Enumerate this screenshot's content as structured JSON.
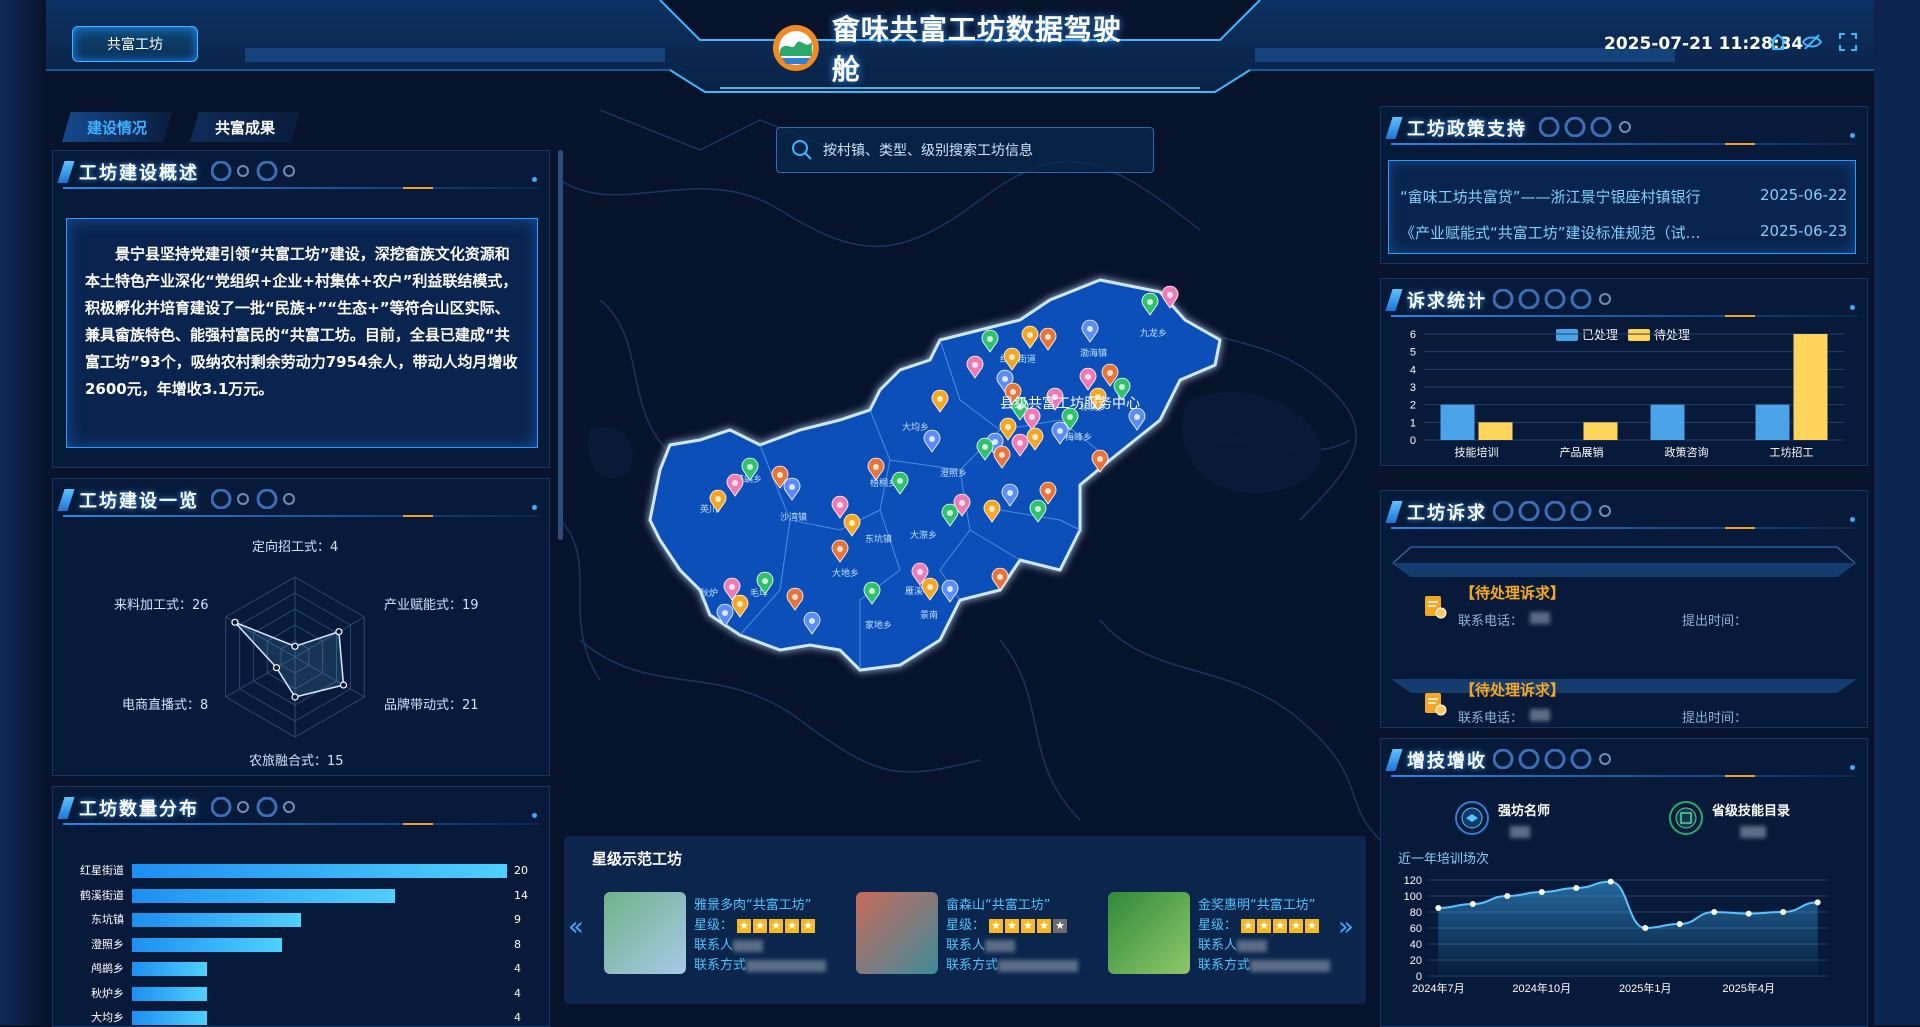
{
  "header": {
    "title": "畲味共富工坊数据驾驶舱",
    "tag_button": "共富工坊",
    "datetime": "2025-07-21 11:28:34",
    "icons": [
      "home-icon",
      "hide-icon",
      "fullscreen-icon"
    ]
  },
  "tabs": [
    {
      "label": "建设情况",
      "active": true
    },
    {
      "label": "共富成果",
      "active": false
    }
  ],
  "overview": {
    "title": "工坊建设概述",
    "text": "景宁县坚持党建引领“共富工坊”建设，深挖畲族文化资源和本土特色产业深化“党组织+企业+村集体+农户”利益联结模式，积极孵化并培育建设了一批“民族+”“生态+”等符合山区实际、兼具畲族特色、能强村富民的“共富工坊。目前，全县已建成“共富工坊”93个，吸纳农村剩余劳动力7954余人，带动人均月增收2600元，年增收3.1万元。"
  },
  "construction": {
    "title": "工坊建设一览",
    "labels": {
      "top": "定向招工式：4",
      "upper_right": "产业赋能式：19",
      "lower_right": "品牌带动式：21",
      "bottom": "农旅融合式：15",
      "lower_left": "电商直播式：8",
      "upper_left": "来料加工式：26"
    },
    "values": [
      4,
      19,
      21,
      15,
      8,
      26
    ],
    "max": 30
  },
  "distribution": {
    "title": "工坊数量分布",
    "items": [
      {
        "name": "红星街道",
        "value": 20
      },
      {
        "name": "鹤溪街道",
        "value": 14
      },
      {
        "name": "东坑镇",
        "value": 9
      },
      {
        "name": "澄照乡",
        "value": 8
      },
      {
        "name": "鸬鹚乡",
        "value": 4
      },
      {
        "name": "秋炉乡",
        "value": 4
      },
      {
        "name": "大均乡",
        "value": 4
      }
    ],
    "max": 20
  },
  "search": {
    "placeholder": "按村镇、类型、级别搜索工坊信息"
  },
  "map": {
    "center_label": "县级共富工坊服务中心",
    "towns": [
      "九龙乡",
      "渤海镇",
      "红星街道",
      "大均乡",
      "梅峰乡",
      "澄照乡",
      "鸬鹚乡",
      "梧桐乡",
      "沙湾镇",
      "英川",
      "东坑镇",
      "大漈乡",
      "标溪乡",
      "大地乡",
      "雁溪",
      "秋炉",
      "毛垟",
      "家地乡",
      "景南"
    ]
  },
  "star_workshops": {
    "title": "星级示范工坊",
    "cards": [
      {
        "name": "雅景多肉“共富工坊”",
        "star_label": "星级：",
        "stars": 5,
        "contact_label": "联系人",
        "phone_label": "联系方式"
      },
      {
        "name": "畲森山“共富工坊”",
        "star_label": "星级：",
        "stars": 4,
        "contact_label": "联系人",
        "phone_label": "联系方式"
      },
      {
        "name": "金奖惠明“共富工坊”",
        "star_label": "星级：",
        "stars": 5,
        "contact_label": "联系人",
        "phone_label": "联系方式"
      }
    ]
  },
  "policy": {
    "title": "工坊政策支持",
    "rows": [
      {
        "text": "“畲味工坊共富贷”——浙江景宁银座村镇银行",
        "date": "2025-06-22"
      },
      {
        "text": "《产业赋能式“共富工坊”建设标准规范（试…",
        "date": "2025-06-23"
      }
    ]
  },
  "appeal_stats": {
    "title": "诉求统计",
    "chart_data": {
      "type": "bar",
      "categories": [
        "技能培训",
        "产品展销",
        "政策咨询",
        "工坊招工"
      ],
      "series": [
        {
          "name": "已处理",
          "values": [
            2,
            0,
            2,
            2
          ],
          "color": "#4aa3e8"
        },
        {
          "name": "待处理",
          "values": [
            1,
            1,
            0,
            6
          ],
          "color": "#ffd45c"
        }
      ],
      "ylim": [
        0,
        6
      ],
      "yticks": [
        0,
        1,
        2,
        3,
        4,
        5,
        6
      ]
    }
  },
  "appeals": {
    "title": "工坊诉求",
    "items": [
      {
        "status": "【待处理诉求】",
        "phone_label": "联系电话：",
        "time_label": "提出时间："
      },
      {
        "status": "【待处理诉求】",
        "phone_label": "联系电话：",
        "time_label": "提出时间："
      }
    ]
  },
  "skills": {
    "title": "增技增收",
    "masters_label": "强坊名师",
    "catalog_label": "省级技能目录",
    "training_title": "近一年培训场次",
    "chart_data": {
      "type": "area",
      "x": [
        "2024年7月",
        "",
        "",
        "2024年10月",
        "",
        "",
        "2025年1月",
        "",
        "",
        "2025年4月",
        "",
        ""
      ],
      "xtick_labels": [
        "2024年7月",
        "2024年10月",
        "2025年1月",
        "2025年4月"
      ],
      "values": [
        85,
        90,
        100,
        105,
        110,
        118,
        60,
        65,
        80,
        78,
        80,
        92
      ],
      "ylim": [
        0,
        120
      ],
      "yticks": [
        0,
        20,
        40,
        60,
        80,
        100,
        120
      ]
    }
  }
}
